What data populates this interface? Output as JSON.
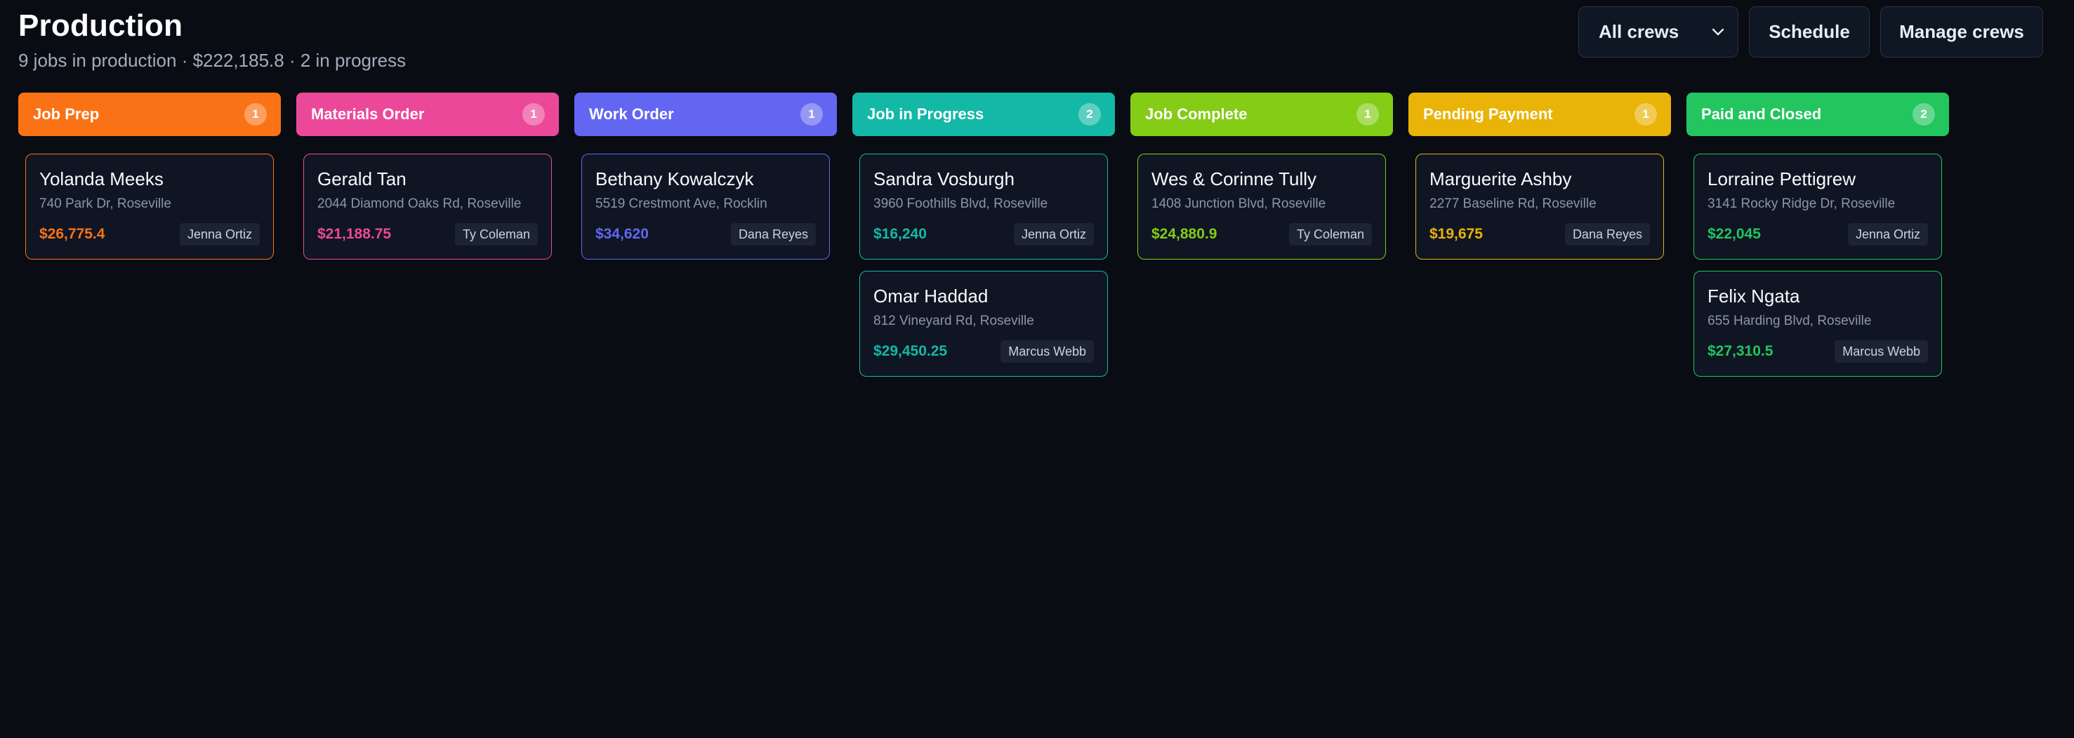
{
  "header": {
    "title": "Production",
    "subtitle": "9 jobs in production · $222,185.8 · 2 in progress"
  },
  "toolbar": {
    "crew_filter": {
      "selected": "All crews",
      "icon": "chevron-down-icon"
    },
    "schedule_label": "Schedule",
    "manage_crews_label": "Manage crews"
  },
  "columns": [
    {
      "id": "job-prep",
      "title": "Job Prep",
      "count": "1",
      "color": "#f97316",
      "cards": [
        {
          "name": "Yolanda Meeks",
          "address": "740 Park Dr, Roseville",
          "amount": "$26,775.4",
          "crew": "Jenna Ortiz"
        }
      ]
    },
    {
      "id": "materials-order",
      "title": "Materials Order",
      "count": "1",
      "color": "#ec4899",
      "cards": [
        {
          "name": "Gerald Tan",
          "address": "2044 Diamond Oaks Rd, Roseville",
          "amount": "$21,188.75",
          "crew": "Ty Coleman"
        }
      ]
    },
    {
      "id": "work-order",
      "title": "Work Order",
      "count": "1",
      "color": "#6366f1",
      "cards": [
        {
          "name": "Bethany Kowalczyk",
          "address": "5519 Crestmont Ave, Rocklin",
          "amount": "$34,620",
          "crew": "Dana Reyes"
        }
      ]
    },
    {
      "id": "job-in-progress",
      "title": "Job in Progress",
      "count": "2",
      "color": "#14b8a6",
      "cards": [
        {
          "name": "Sandra Vosburgh",
          "address": "3960 Foothills Blvd, Roseville",
          "amount": "$16,240",
          "crew": "Jenna Ortiz"
        },
        {
          "name": "Omar Haddad",
          "address": "812 Vineyard Rd, Roseville",
          "amount": "$29,450.25",
          "crew": "Marcus Webb"
        }
      ]
    },
    {
      "id": "job-complete",
      "title": "Job Complete",
      "count": "1",
      "color": "#84cc16",
      "cards": [
        {
          "name": "Wes & Corinne Tully",
          "address": "1408 Junction Blvd, Roseville",
          "amount": "$24,880.9",
          "crew": "Ty Coleman"
        }
      ]
    },
    {
      "id": "pending-payment",
      "title": "Pending Payment",
      "count": "1",
      "color": "#eab308",
      "cards": [
        {
          "name": "Marguerite Ashby",
          "address": "2277 Baseline Rd, Roseville",
          "amount": "$19,675",
          "crew": "Dana Reyes"
        }
      ]
    },
    {
      "id": "paid-and-closed",
      "title": "Paid and Closed",
      "count": "2",
      "color": "#22c55e",
      "cards": [
        {
          "name": "Lorraine Pettigrew",
          "address": "3141 Rocky Ridge Dr, Roseville",
          "amount": "$22,045",
          "crew": "Jenna Ortiz"
        },
        {
          "name": "Felix Ngata",
          "address": "655 Harding Blvd, Roseville",
          "amount": "$27,310.5",
          "crew": "Marcus Webb"
        }
      ]
    }
  ]
}
